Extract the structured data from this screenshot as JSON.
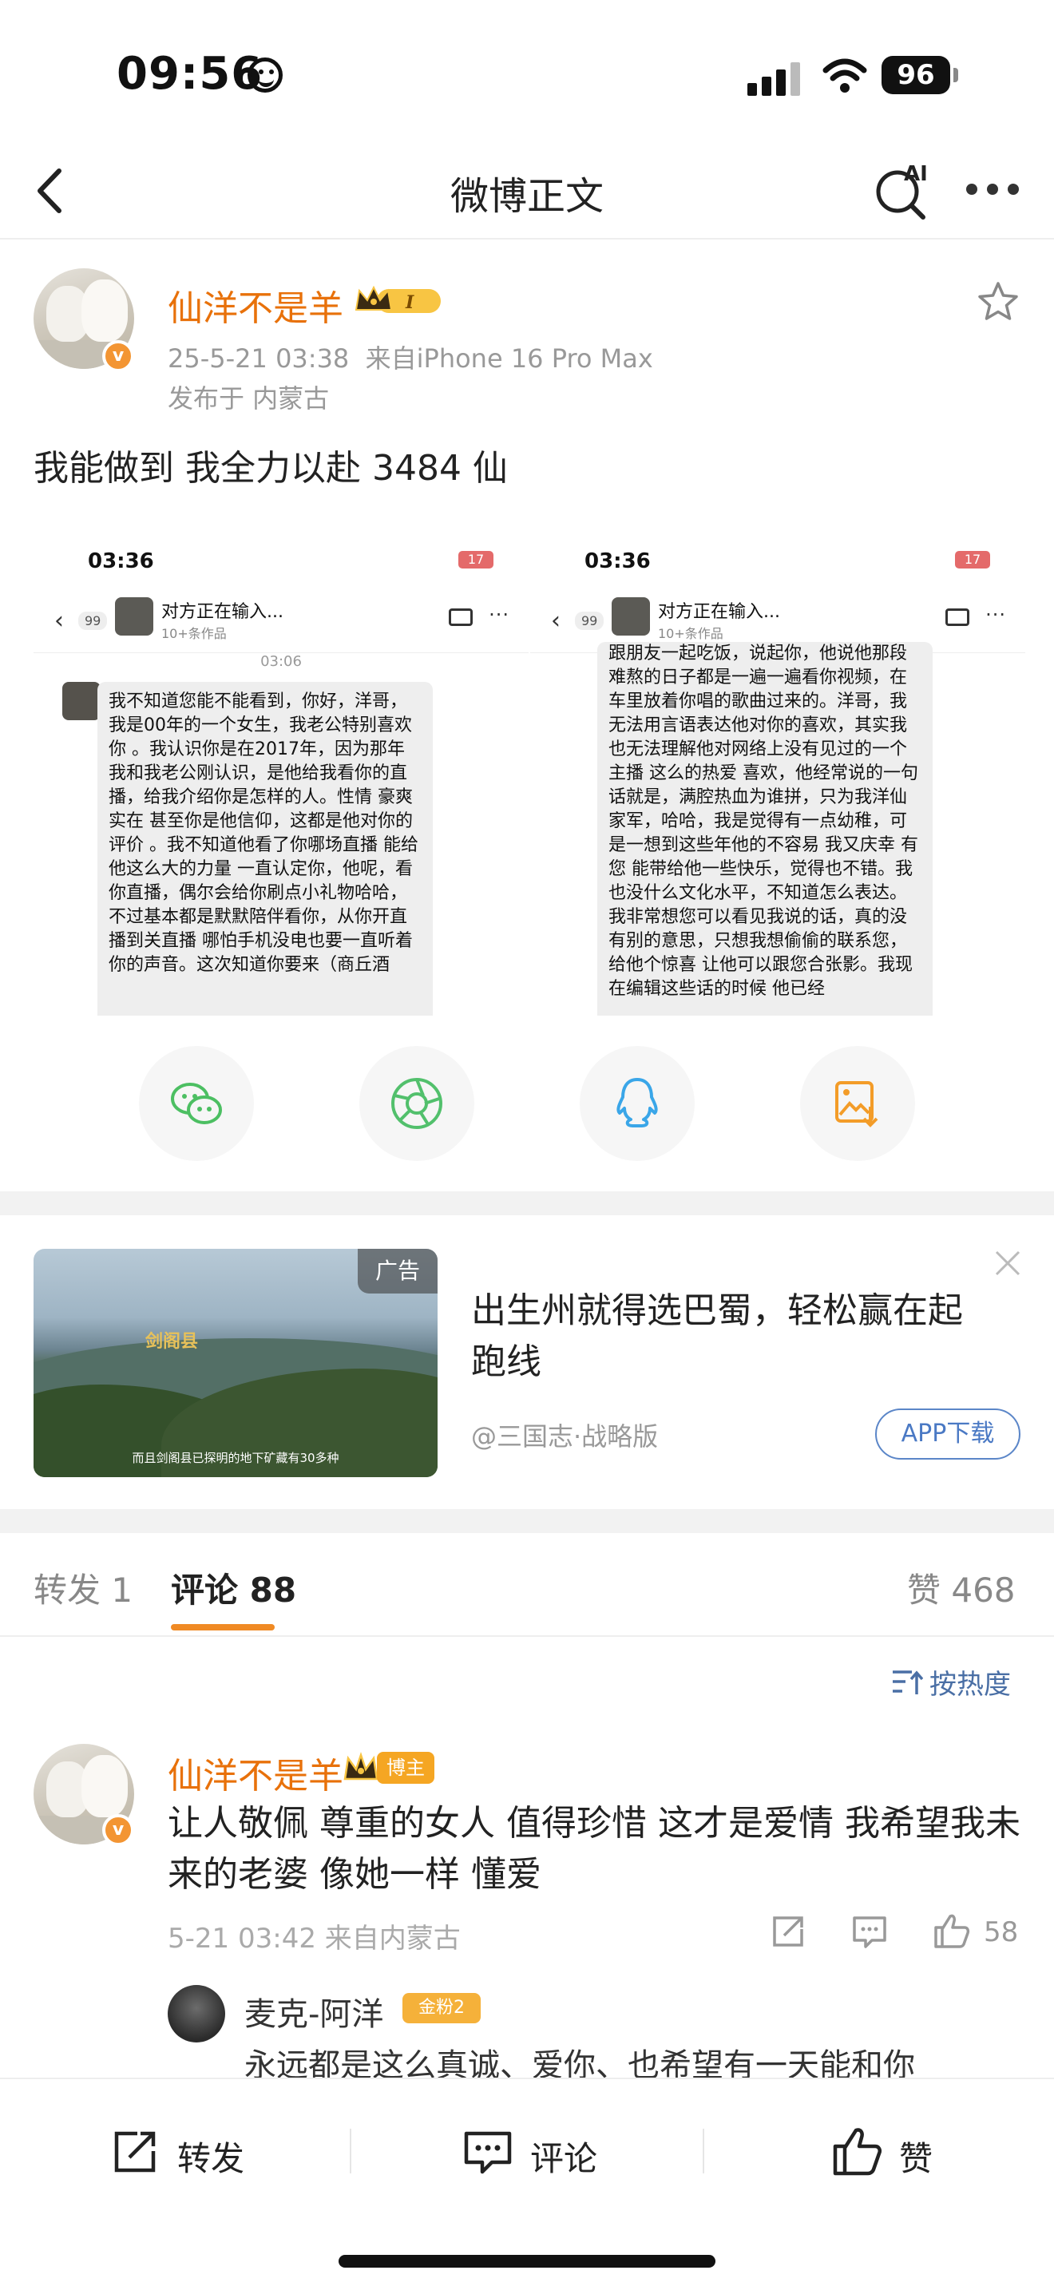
{
  "status_bar": {
    "time": "09:56",
    "battery": "96"
  },
  "nav": {
    "title": "微博正文",
    "ai_label": "AI"
  },
  "post": {
    "author": "仙洋不是羊",
    "badge_level": "I",
    "timestamp": "25-5-21 03:38",
    "source": "来自iPhone 16 Pro Max",
    "location": "发布于 内蒙古",
    "text": "我能做到 我全力以赴 3484 仙",
    "images": [
      {
        "time": "03:36",
        "battery": "17",
        "count": "99",
        "chat_title": "对方正在输入...",
        "chat_sub": "10+条作品",
        "timestamp": "03:06",
        "message": "我不知道您能不能看到，你好，洋哥，我是00年的一个女生，我老公特别喜欢你 。我认识你是在2017年，因为那年我和我老公刚认识，是他给我看你的直播，给我介绍你是怎样的人。性情 豪爽 实在 甚至你是他信仰，这都是他对你的评价 。我不知道他看了你哪场直播 能给他这么大的力量 一直认定你，他呢，看你直播，偶尔会给你刷点小礼物哈哈，不过基本都是默默陪伴看你，从你开直播到关直播 哪怕手机没电也要一直听着你的声音。这次知道你要来（商丘酒"
      },
      {
        "time": "03:36",
        "battery": "17",
        "count": "99",
        "chat_title": "对方正在输入...",
        "chat_sub": "10+条作品",
        "message": "跟朋友一起吃饭，说起你，他说他那段难熬的日子都是一遍一遍看你视频，在车里放着你唱的歌曲过来的。洋哥，我无法用言语表达他对你的喜欢，其实我也无法理解他对网络上没有见过的一个主播 这么的热爱 喜欢，他经常说的一句话就是，满腔热血为谁拼，只为我洋仙家军，哈哈，我是觉得有一点幼稚，可是一想到这些年他的不容易 我又庆幸 有您 能带给他一些快乐，觉得也不错。我也没什么文化水平，不知道怎么表达。我非常想您可以看见我说的话，真的没有别的意思，只想我想偷偷的联系您，给他个惊喜 让他可以跟您合张影。我现在编辑这些话的时候 他已经"
      }
    ]
  },
  "share": {
    "items": [
      "wechat-icon",
      "moments-icon",
      "qq-icon",
      "save-image-icon"
    ]
  },
  "ad": {
    "tag": "广告",
    "title": "出生州就得选巴蜀，轻松赢在起跑线",
    "source": "@三国志·战略版",
    "button": "APP下载",
    "image_logo": "剑阁县",
    "image_caption": "而且剑阁县已探明的地下矿藏有30多种"
  },
  "tabs": {
    "repost": "转发 1",
    "comments": "评论 88",
    "likes": "赞 468"
  },
  "sort_label": "按热度",
  "comment": {
    "author": "仙洋不是羊",
    "badge": "博主",
    "text": "让人敬佩 尊重的女人 值得珍惜 这才是爱情 我希望我未来的老婆 像她一样 懂爱",
    "meta": "5-21 03:42 来自内蒙古",
    "likes": "58",
    "reply": {
      "author": "麦克-阿洋",
      "badge": "金粉2",
      "text": "永远都是这么真诚、爱你、也希望有一天能和你"
    }
  },
  "bottom_bar": {
    "repost": "转发",
    "comment": "评论",
    "like": "赞"
  },
  "colors": {
    "accent_orange": "#e8710a",
    "tab_underline": "#f08a24",
    "link_blue": "#4a6fa5"
  }
}
